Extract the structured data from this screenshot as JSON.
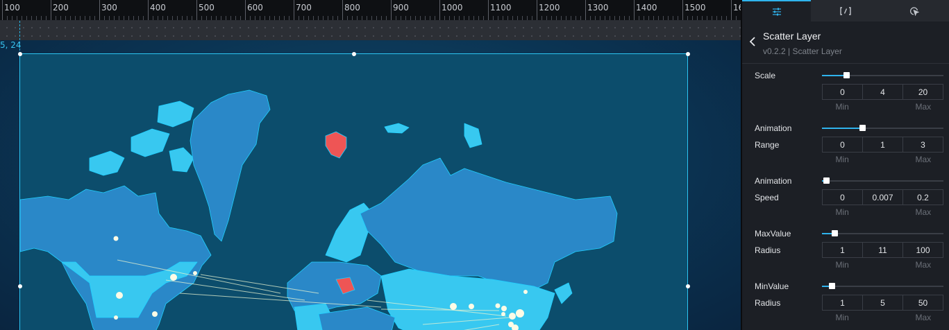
{
  "ruler": {
    "ticks": [
      "100",
      "200",
      "300",
      "400",
      "500",
      "600",
      "700",
      "800",
      "900",
      "1000",
      "1100",
      "1200",
      "1300",
      "1400",
      "1500",
      "16"
    ]
  },
  "canvas": {
    "coord_label": "5, 24"
  },
  "map": {
    "land_color": "#2a88c8",
    "land_light": "#38c8f0",
    "highlight_color": "#ee5555",
    "border_color": "#1fd0ff",
    "point_color": "#fdfbe6"
  },
  "panel": {
    "tabs": [
      {
        "name": "settings-sliders-icon",
        "active": true
      },
      {
        "name": "code-braces-icon",
        "active": false
      },
      {
        "name": "click-interaction-icon",
        "active": false
      }
    ],
    "title": "Scatter Layer",
    "subtitle": "v0.2.2 | Scatter Layer",
    "accent": "#2fb4ee",
    "props": [
      {
        "label": "Scale",
        "label2": "",
        "min": "0",
        "value": "4",
        "max": "20",
        "level": 0.2,
        "min_caption": "Min",
        "max_caption": "Max"
      },
      {
        "label": "Animation",
        "label2": "Range",
        "min": "0",
        "value": "1",
        "max": "3",
        "level": 0.33,
        "min_caption": "Min",
        "max_caption": "Max"
      },
      {
        "label": "Animation",
        "label2": "Speed",
        "min": "0",
        "value": "0.007",
        "max": "0.2",
        "level": 0.035,
        "min_caption": "Min",
        "max_caption": "Max"
      },
      {
        "label": "MaxValue",
        "label2": "Radius",
        "min": "1",
        "value": "11",
        "max": "100",
        "level": 0.1,
        "min_caption": "Min",
        "max_caption": "Max"
      },
      {
        "label": "MinValue",
        "label2": "Radius",
        "min": "1",
        "value": "5",
        "max": "50",
        "level": 0.08,
        "min_caption": "Min",
        "max_caption": "Max"
      }
    ]
  }
}
